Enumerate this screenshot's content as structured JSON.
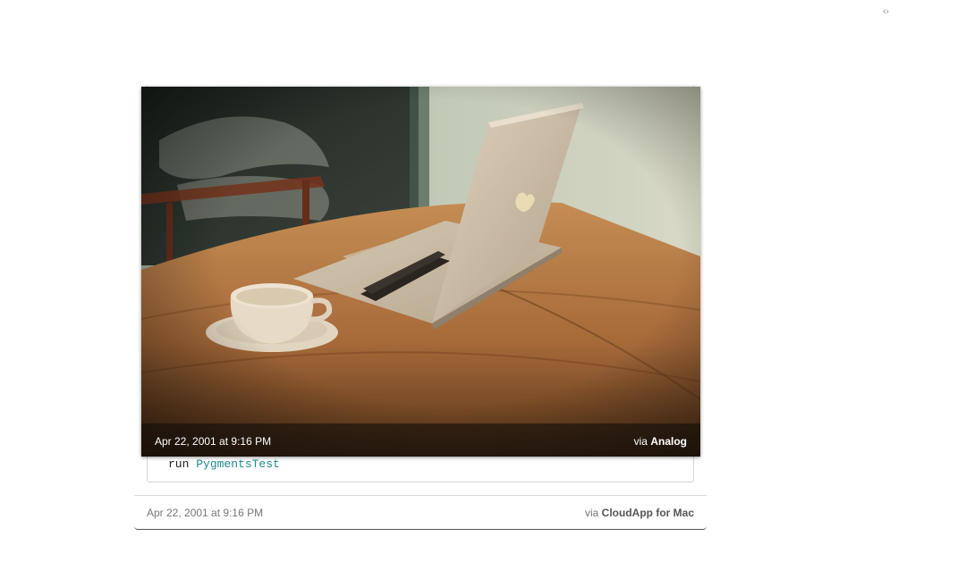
{
  "toolbar": {
    "toggle_icon": "code-toggle-icon",
    "toggle_glyph": "‹›"
  },
  "photo": {
    "alt_subject": "laptop-and-coffee-cup",
    "caption": {
      "date": "Apr 22, 2001 at 9:16 PM",
      "via_prefix": "via",
      "via_source": "Analog"
    }
  },
  "code": {
    "keyword": "run",
    "identifier": "PygmentsTest"
  },
  "footer": {
    "date": "Apr 22, 2001 at 9:16 PM",
    "via_prefix": "via",
    "via_source": "CloudApp for Mac"
  },
  "colors": {
    "identifier": "#1f8a8a",
    "caption_bar": "#140e0a"
  }
}
